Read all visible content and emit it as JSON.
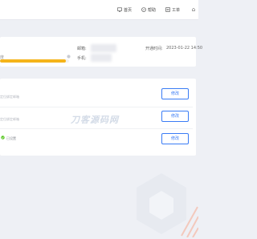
{
  "topnav": {
    "home": "首页",
    "help": "帮助",
    "ticket": "工单"
  },
  "account": {
    "email_label": "邮箱:",
    "phone_label": "手机:",
    "open_time_label": "开通时间:",
    "open_time_value": "2023-01-22 14:50",
    "progress_caption": "度",
    "progress_percent": 95
  },
  "security": {
    "rows": [
      {
        "desc": "定位绑定邮箱",
        "button": "修改"
      },
      {
        "desc": "定位绑定邮箱",
        "button": "修改"
      },
      {
        "desc": "已设置",
        "button": "修改"
      }
    ]
  },
  "watermark": "刀客源码网",
  "colors": {
    "accent": "#3a7cf5",
    "progress": "#f5b41a",
    "success": "#52c41a"
  }
}
